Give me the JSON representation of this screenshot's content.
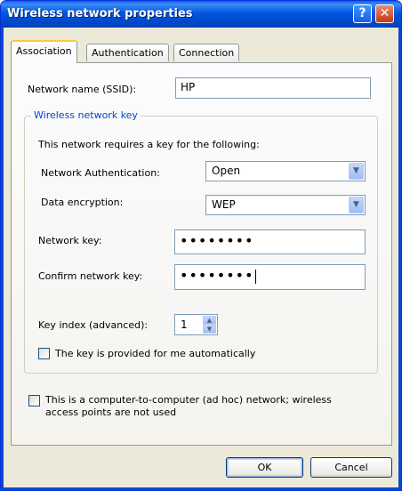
{
  "window": {
    "title": "Wireless network properties",
    "help_icon": "question-mark",
    "close_icon": "x-mark"
  },
  "tabs": [
    {
      "label": "Association",
      "active": true
    },
    {
      "label": "Authentication",
      "active": false
    },
    {
      "label": "Connection",
      "active": false
    }
  ],
  "association": {
    "ssid_label": "Network name (SSID):",
    "ssid_value": "HP",
    "group_title": "Wireless network key",
    "key_info": "This network requires a key for the following:",
    "auth_label": "Network Authentication:",
    "auth_value": "Open",
    "encryption_label": "Data encryption:",
    "encryption_value": "WEP",
    "network_key_label": "Network key:",
    "network_key_value": "••••••••",
    "confirm_key_label": "Confirm network key:",
    "confirm_key_value": "••••••••",
    "key_index_label": "Key index (advanced):",
    "key_index_value": "1",
    "auto_key_label": "The key is provided for me automatically",
    "adhoc_label_line1": "This is a computer-to-computer (ad hoc) network; wireless",
    "adhoc_label_line2": "access points are not used"
  },
  "buttons": {
    "ok": "OK",
    "cancel": "Cancel"
  },
  "colors": {
    "titlebar": "#0054e3",
    "group_title": "#0046d5",
    "tab_highlight": "#ffc83c"
  }
}
